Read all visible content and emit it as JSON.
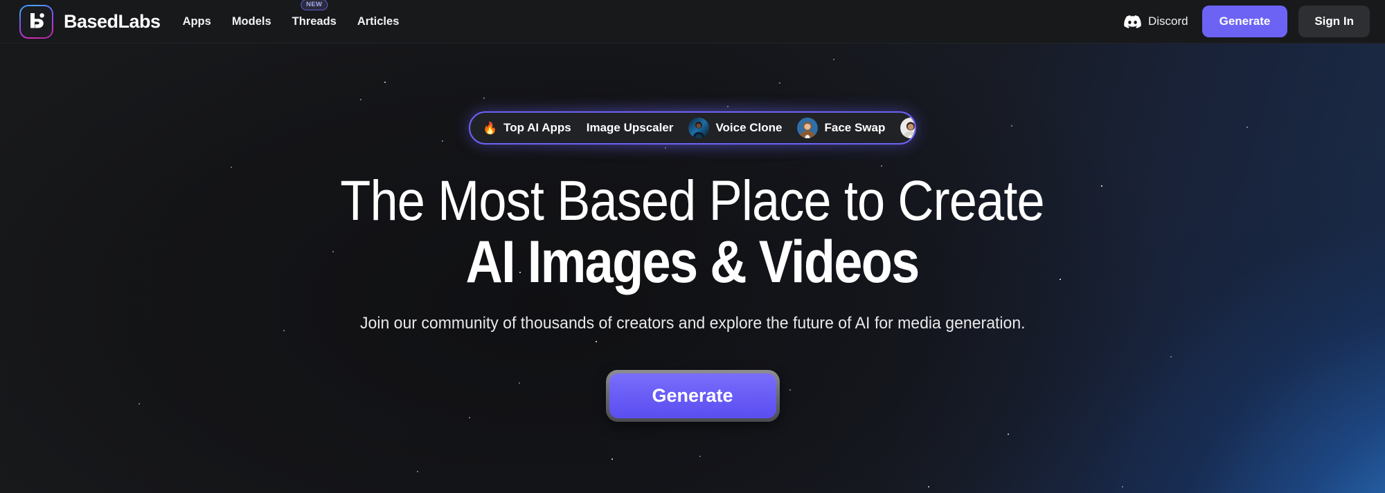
{
  "brand": {
    "name": "BasedLabs",
    "logo_icon": "basedlabs-b-logo-icon"
  },
  "nav": {
    "links": [
      {
        "label": "Apps",
        "badge": null
      },
      {
        "label": "Models",
        "badge": null
      },
      {
        "label": "Threads",
        "badge": "NEW"
      },
      {
        "label": "Articles",
        "badge": null
      }
    ],
    "discord": {
      "label": "Discord",
      "icon": "discord-icon"
    },
    "generate_label": "Generate",
    "signin_label": "Sign In"
  },
  "hero": {
    "pill_items": [
      {
        "emoji": "🔥",
        "label": "Top AI Apps",
        "avatar": null
      },
      {
        "emoji": null,
        "label": "Image Upscaler",
        "avatar": "avatar-blue-portrait"
      },
      {
        "emoji": null,
        "label": "Voice Clone",
        "avatar": "avatar-woman-brown-hair"
      },
      {
        "emoji": null,
        "label": "Face Swap",
        "avatar": "avatar-woman-light-bg"
      }
    ],
    "headline_line1": "The Most Based Place to Create",
    "headline_line2": "AI Images & Videos",
    "subhead": "Join our community of thousands of creators and explore the future of AI for media generation.",
    "cta_label": "Generate"
  },
  "colors": {
    "background": "#18191b",
    "accent_purple": "#6c63f5",
    "glow_blue": "#2e82d6",
    "nav_border": "#232427",
    "signin_bg": "#2e2f33",
    "badge_text": "#a9abf5"
  }
}
